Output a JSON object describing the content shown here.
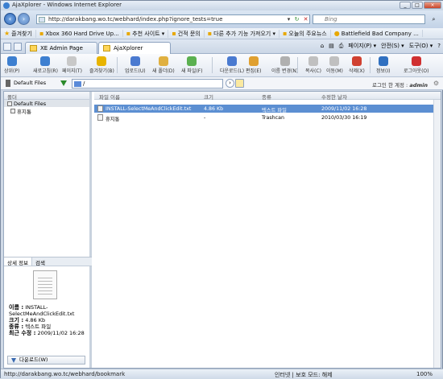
{
  "browser": {
    "title": "AjaXplorer - Windows Internet Explorer",
    "url": "http://darakbang.wo.tc/webhard/index.php?ignore_tests=true",
    "search_placeholder": "Bing",
    "favorites_label": "즐겨찾기",
    "favorites": [
      "Xbox 360 Hard Drive Up...",
      "추천 사이트 ▾",
      "건적 문의",
      "다른 추가 기능 가져오기 ▾",
      "오늘의 주요뉴스",
      "Battlefield Bad Company ..."
    ],
    "tabs": [
      "XE Admin Page",
      "AjaXplorer"
    ],
    "commands": [
      "페이지(P) ▾",
      "안전(S) ▾",
      "도구(O) ▾"
    ],
    "status_url": "http://darakbang.wo.tc/webhard/bookmark",
    "status_zone": "인터넷 | 보호 모드: 해제",
    "zoom": "100%"
  },
  "toolbar": {
    "buttons": [
      {
        "label": "상위(P)",
        "color": "#3d7fd0"
      },
      {
        "label": "새로고침(R)",
        "color": "#3d7fd0"
      },
      {
        "label": "페이지(T)",
        "color": "#c8c8c8"
      },
      {
        "label": "즐겨찾기(B)",
        "color": "#e8b400"
      },
      {
        "label": "업로드(U)",
        "color": "#4a7ad0"
      },
      {
        "label": "새 폴더(D)",
        "color": "#e0b040"
      },
      {
        "label": "새 파일(F)",
        "color": "#5bb050"
      },
      {
        "label": "다운로드(L)",
        "color": "#4a7ad0"
      },
      {
        "label": "편집(E)",
        "color": "#e0a030"
      },
      {
        "label": "이름 변경(N)",
        "color": "#b0b0b0"
      },
      {
        "label": "복사(C)",
        "color": "#c0c0c0"
      },
      {
        "label": "이동(M)",
        "color": "#c0c0c0"
      },
      {
        "label": "삭제(X)",
        "color": "#d04030"
      },
      {
        "label": "정보(I)",
        "color": "#3070c0"
      },
      {
        "label": "로그아웃(O)",
        "color": "#d03030"
      }
    ]
  },
  "location": {
    "repository": "Default Files",
    "path": "/",
    "user_label": "로그인 한 계정 :",
    "user": "admin"
  },
  "tree": {
    "header": "폴더",
    "items": [
      "Default Files",
      "휴지통"
    ]
  },
  "info_panel": {
    "tabs": [
      "상세 정보",
      "검색"
    ],
    "name_label": "이름 :",
    "name_value": "INSTALL-SelectMeAndClickEdit.txt",
    "size_label": "크기 :",
    "size_value": "4.86 Kb",
    "type_label": "종류 :",
    "type_value": "텍스트 파일",
    "modified_label": "최근 수정 :",
    "modified_value": "2009/11/02 16:28",
    "download_label": "다운로드(W)"
  },
  "files": {
    "columns": [
      "파일 이름",
      "크기",
      "종류",
      "수정한 날자"
    ],
    "rows": [
      {
        "name": "INSTALL-SelectMeAndClickEdit.txt",
        "size": "4.86 Kb",
        "type": "텍스트 파일",
        "date": "2009/11/02 16:28"
      },
      {
        "name": "휴지통",
        "size": "-",
        "type": "Trashcan",
        "date": "2010/03/30 16:19"
      }
    ]
  }
}
